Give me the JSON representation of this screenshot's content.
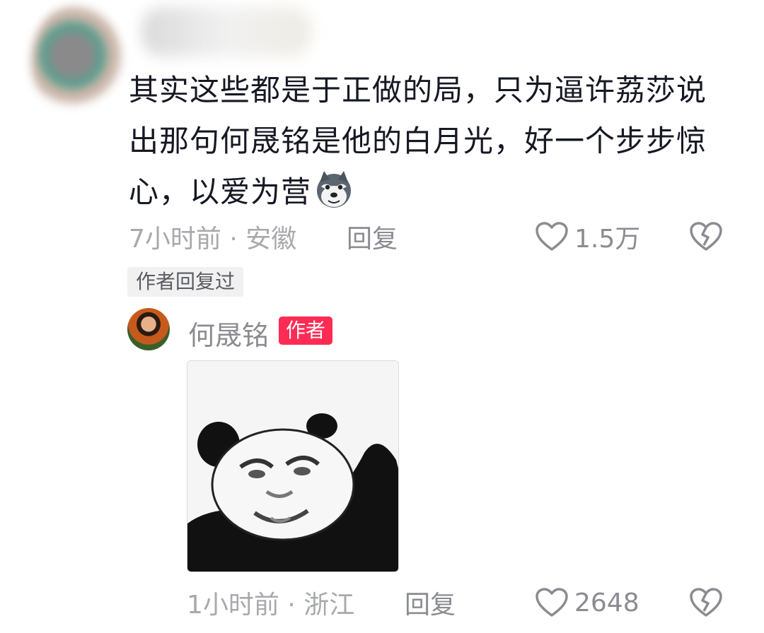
{
  "comment": {
    "text": "其实这些都是于正做的局，只为逼许荔莎说出那句何晟铭是他的白月光，好一个步步惊心，以爱为营",
    "emoji_icon": "wolf-face-emoji-icon",
    "meta": "7小时前 · 安徽",
    "reply_label": "回复",
    "likes": "1.5万"
  },
  "author_replied_tag": "作者回复过",
  "reply": {
    "author_name": "何晟铭",
    "author_badge": "作者",
    "sticker_icon": "panda-meme-sticker",
    "meta": "1小时前 · 浙江",
    "reply_label": "回复",
    "likes": "2648"
  },
  "colors": {
    "text": "#161823",
    "muted": "#a8a9ad",
    "secondary": "#8b8c91",
    "badge": "#fe2c55",
    "tag_bg": "#f1f1f2"
  }
}
